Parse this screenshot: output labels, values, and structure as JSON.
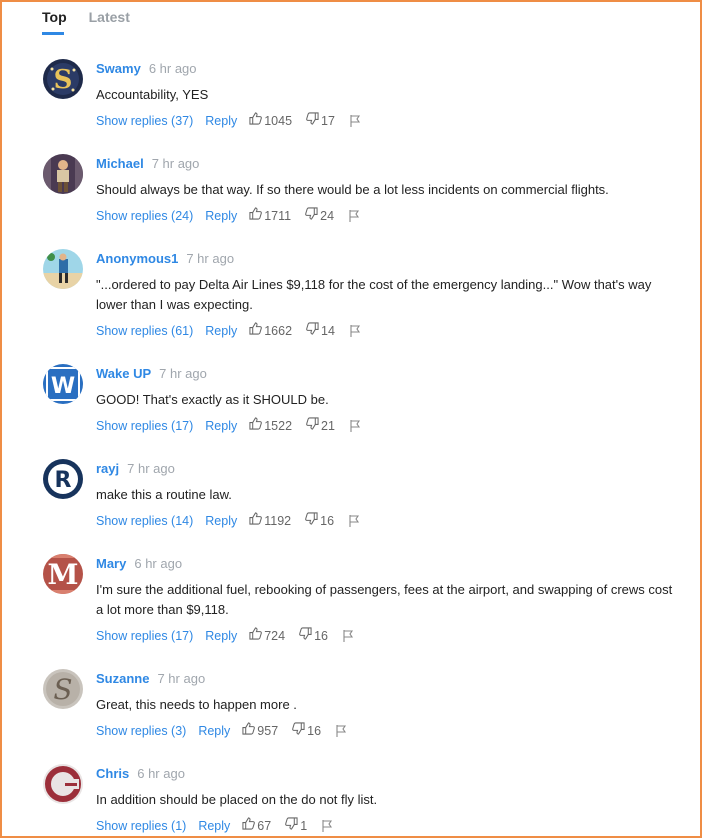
{
  "tabs": {
    "top": "Top",
    "latest": "Latest"
  },
  "colors": {
    "accent": "#2f88e4",
    "border": "#ef8d45",
    "muted": "#a0a6ad"
  },
  "labels": {
    "reply": "Reply"
  },
  "comments": [
    {
      "author": "Swamy",
      "time": "6 hr ago",
      "text": "Accountability, YES",
      "replies": "Show replies (37)",
      "up": "1045",
      "down": "17"
    },
    {
      "author": "Michael",
      "time": "7 hr ago",
      "text": "Should always be that way. If so there would be a lot less incidents on commercial flights.",
      "replies": "Show replies (24)",
      "up": "1711",
      "down": "24"
    },
    {
      "author": "Anonymous1",
      "time": "7 hr ago",
      "text": "\"...ordered to pay Delta Air Lines $9,118 for the cost of the emergency landing...\" Wow that's way lower than I was expecting.",
      "replies": "Show replies (61)",
      "up": "1662",
      "down": "14"
    },
    {
      "author": "Wake UP",
      "time": "7 hr ago",
      "text": "GOOD! That's exactly as it SHOULD be.",
      "replies": "Show replies (17)",
      "up": "1522",
      "down": "21"
    },
    {
      "author": "rayj",
      "time": "7 hr ago",
      "text": "make this a routine law.",
      "replies": "Show replies (14)",
      "up": "1192",
      "down": "16"
    },
    {
      "author": "Mary",
      "time": "6 hr ago",
      "text": "I'm sure the additional fuel, rebooking of passengers, fees at the airport, and swapping of crews cost a lot more than $9,118.",
      "replies": "Show replies (17)",
      "up": "724",
      "down": "16"
    },
    {
      "author": "Suzanne",
      "time": "7 hr ago",
      "text": "Great, this needs to happen more .",
      "replies": "Show replies (3)",
      "up": "957",
      "down": "16"
    },
    {
      "author": "Chris",
      "time": "6 hr ago",
      "text": "In addition should be placed on the do not fly list.",
      "replies": "Show replies (1)",
      "up": "67",
      "down": "1"
    }
  ]
}
